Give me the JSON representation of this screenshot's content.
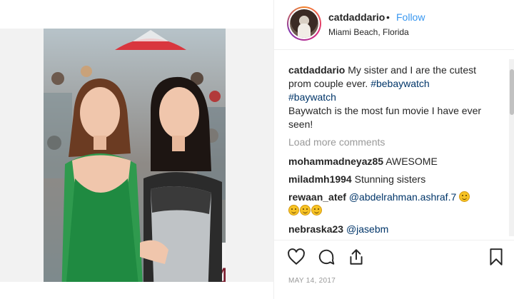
{
  "post": {
    "username": "catdaddario",
    "separator": "•",
    "follow_label": "Follow",
    "location": "Miami Beach, Florida",
    "caption": {
      "username": "catdaddario",
      "text_1": "My sister and I are the cutest prom couple ever.",
      "hashtag_1": "#bebaywatch",
      "hashtag_2": "#baywatch",
      "text_2": "Baywatch is the most fun movie I have ever seen!"
    },
    "load_more_label": "Load more comments",
    "comments": [
      {
        "username": "mohammadneyaz85",
        "text": "AWESOME"
      },
      {
        "username": "miladmh1994",
        "text": "Stunning sisters"
      },
      {
        "username": "rewaan_atef",
        "mention": "@abdelrahman.ashraf.7",
        "emoji_inline": "smiling-face",
        "emoji_line": [
          "smiling-face",
          "smiling-face",
          "smiling-face"
        ]
      },
      {
        "username": "nebraska23",
        "mention": "@jasebm"
      }
    ],
    "date": "MAY 14, 2017",
    "icons": {
      "like": "heart-icon",
      "comment": "comment-icon",
      "share": "share-icon",
      "save": "bookmark-icon"
    }
  }
}
